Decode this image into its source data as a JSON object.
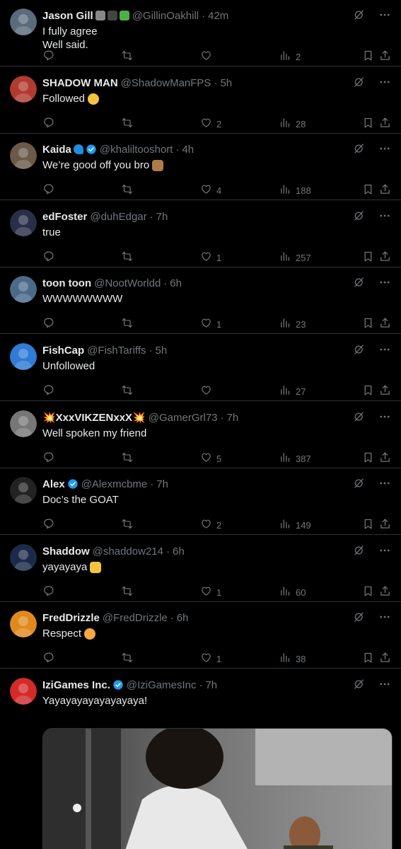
{
  "tweets": [
    {
      "name": "Jason Gill",
      "handle": "@GillinOakhill",
      "time": "42m",
      "lines": [
        "I fully agree",
        "Well said."
      ],
      "replies": "",
      "retweets": "",
      "likes": "",
      "views": "2",
      "verified": false,
      "badges": true,
      "avatar_color": "#5a6b7c"
    },
    {
      "name": "SHADOW MAN",
      "handle": "@ShadowManFPS",
      "time": "5h",
      "lines": [
        "Followed"
      ],
      "emoji": "smile",
      "replies": "",
      "retweets": "",
      "likes": "2",
      "views": "28",
      "verified": false,
      "avatar_color": "#b23a2f"
    },
    {
      "name": "Kaida",
      "handle": "@khaliltooshort",
      "time": "4h",
      "lines": [
        "We’re good off you bro"
      ],
      "emoji": "peace",
      "name_emoji": "wave",
      "replies": "",
      "retweets": "",
      "likes": "4",
      "views": "188",
      "verified": true,
      "avatar_color": "#6b5a4a"
    },
    {
      "name": "edFoster",
      "handle": "@duhEdgar",
      "time": "7h",
      "lines": [
        "true"
      ],
      "replies": "",
      "retweets": "",
      "likes": "1",
      "views": "257",
      "verified": false,
      "avatar_color": "#2a2e48"
    },
    {
      "name": "toon toon",
      "handle": "@NootWorldd",
      "time": "6h",
      "lines": [
        "WWWWWWWW"
      ],
      "replies": "",
      "retweets": "",
      "likes": "1",
      "views": "23",
      "verified": false,
      "avatar_color": "#4a6a8a"
    },
    {
      "name": "FishCap",
      "handle": "@FishTariffs",
      "time": "5h",
      "lines": [
        "Unfollowed"
      ],
      "replies": "",
      "retweets": "",
      "likes": "",
      "views": "27",
      "verified": false,
      "avatar_color": "#2f7bd6"
    },
    {
      "name": "💥XxxVIKZENxxX💥",
      "handle": "@GamerGrl73",
      "time": "7h",
      "lines": [
        "Well spoken my friend"
      ],
      "replies": "",
      "retweets": "",
      "likes": "5",
      "views": "387",
      "verified": false,
      "avatar_color": "#777777"
    },
    {
      "name": "Alex",
      "handle": "@Alexmcbme",
      "time": "7h",
      "lines": [
        "Doc’s the GOAT"
      ],
      "replies": "",
      "retweets": "",
      "likes": "2",
      "views": "149",
      "verified": true,
      "avatar_color": "#222222"
    },
    {
      "name": "Shaddow",
      "handle": "@shaddow214",
      "time": "6h",
      "lines": [
        "yayayaya"
      ],
      "emoji": "handshake",
      "replies": "",
      "retweets": "",
      "likes": "1",
      "views": "60",
      "verified": false,
      "avatar_color": "#1c2a4a"
    },
    {
      "name": "FredDrizzle",
      "handle": "@FredDrizzle",
      "time": "6h",
      "lines": [
        "Respect"
      ],
      "emoji": "salute",
      "replies": "",
      "retweets": "",
      "likes": "1",
      "views": "38",
      "verified": false,
      "avatar_color": "#e08a1e"
    },
    {
      "name": "IziGames Inc.",
      "handle": "@IziGamesInc",
      "time": "7h",
      "lines": [
        "Yayayayayayayayaya!"
      ],
      "replies": "",
      "retweets": "",
      "likes": "",
      "views": "",
      "verified": true,
      "avatar_color": "#d42a2a",
      "has_media": true
    }
  ],
  "colors": {
    "verified": "#1d9bf0",
    "text": "#e7e9ea",
    "muted": "#71767b",
    "divider": "#2f3336"
  },
  "icons": {
    "grok": "grok-icon",
    "more": "more-icon",
    "reply": "reply-icon",
    "retweet": "retweet-icon",
    "like": "heart-icon",
    "views": "views-icon",
    "bookmark": "bookmark-icon",
    "share": "share-icon"
  }
}
